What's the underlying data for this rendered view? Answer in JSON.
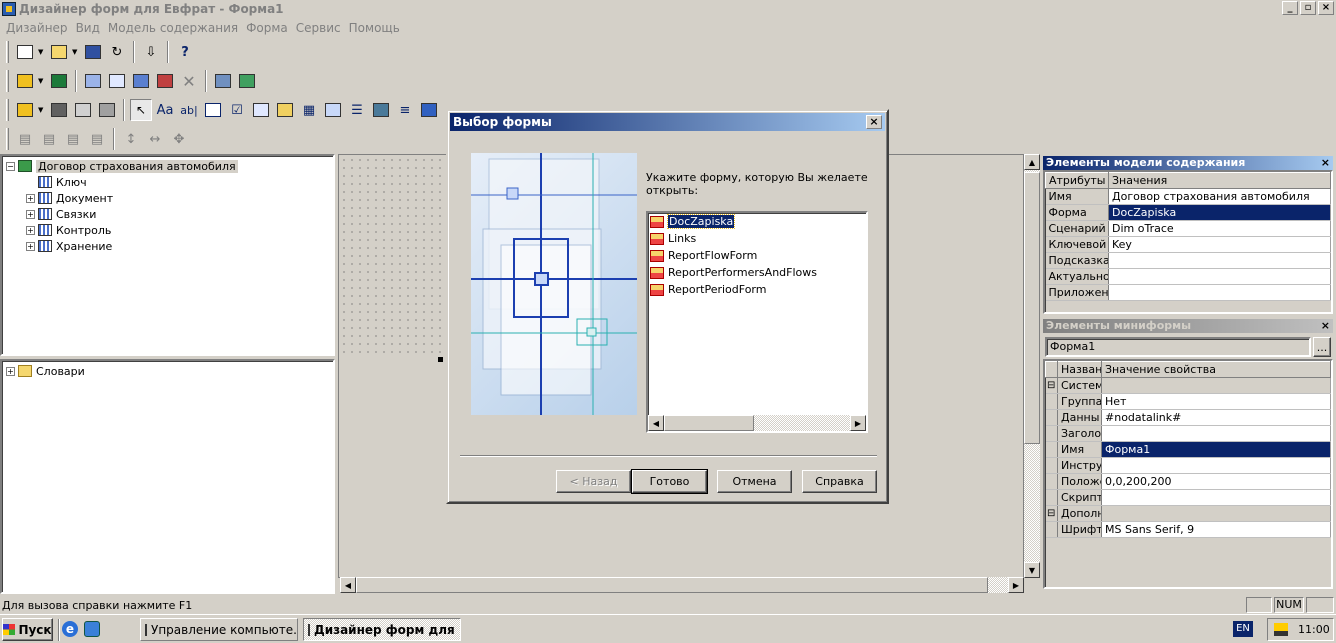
{
  "window": {
    "title": "Дизайнер форм для Евфрат - Форма1",
    "min": "_",
    "max": "▫",
    "close": "×"
  },
  "menu": [
    "Дизайнер",
    "Вид",
    "Модель содержания",
    "Форма",
    "Сервис",
    "Помощь"
  ],
  "tree": {
    "root": "Договор страхования автомобиля",
    "items": [
      {
        "label": "Ключ",
        "expand": ""
      },
      {
        "label": "Документ",
        "expand": "+"
      },
      {
        "label": "Связки",
        "expand": "+"
      },
      {
        "label": "Контроль",
        "expand": "+"
      },
      {
        "label": "Хранение",
        "expand": "+"
      }
    ],
    "dict_expand": "+",
    "dict": "Словари"
  },
  "dialog": {
    "title": "Выбор формы",
    "close": "×",
    "prompt": "Укажите форму, которую Вы желаете открыть:",
    "forms": [
      "DocZapiska",
      "Links",
      "ReportFlowForm",
      "ReportPerformersAndFlows",
      "ReportPeriodForm"
    ],
    "back": "< Назад",
    "finish": "Готово",
    "cancel": "Отмена",
    "help": "Справка"
  },
  "model_panel": {
    "title": "Элементы модели содержания",
    "close": "×",
    "col_attr": "Атрибуты",
    "col_val": "Значения",
    "rows": [
      {
        "k": "Имя",
        "v": "Договор страхования автомобиля"
      },
      {
        "k": "Форма",
        "v": "DocZapiska"
      },
      {
        "k": "Сценарий",
        "v": "Dim oTrace"
      },
      {
        "k": "Ключевой э",
        "v": "Key"
      },
      {
        "k": "Подсказка",
        "v": ""
      },
      {
        "k": "Актуальнос",
        "v": ""
      },
      {
        "k": "Приложени",
        "v": ""
      }
    ]
  },
  "mini_panel": {
    "title": "Элементы миниформы",
    "close": "×",
    "combo": "Форма1",
    "combo_btn": "...",
    "col_name": "Назван",
    "col_val": "Значение свойства",
    "rows": [
      {
        "e": "⊟",
        "k": "Систем",
        "v": ""
      },
      {
        "e": "",
        "k": "Группа",
        "v": "Нет"
      },
      {
        "e": "",
        "k": "Данны",
        "v": "#nodatalink#"
      },
      {
        "e": "",
        "k": "Заголо",
        "v": ""
      },
      {
        "e": "",
        "k": "Имя",
        "v": "Форма1"
      },
      {
        "e": "",
        "k": "Инстру",
        "v": ""
      },
      {
        "e": "",
        "k": "Положе",
        "v": "0,0,200,200"
      },
      {
        "e": "",
        "k": "Скрипт",
        "v": ""
      },
      {
        "e": "⊟",
        "k": "Дополн",
        "v": ""
      },
      {
        "e": "",
        "k": "Шрифт",
        "v": "MS Sans Serif, 9"
      }
    ]
  },
  "status": {
    "text": "Для вызова справки нажмите F1",
    "num": "NUM"
  },
  "taskbar": {
    "start": "Пуск",
    "tasks": [
      "Управление компьюте...",
      "Дизайнер форм для ..."
    ],
    "lang": "EN",
    "clock": "11:00"
  },
  "colors": {
    "selection": "#0a246a",
    "titlebar": "#0a246a",
    "face": "#d4d0c8"
  }
}
